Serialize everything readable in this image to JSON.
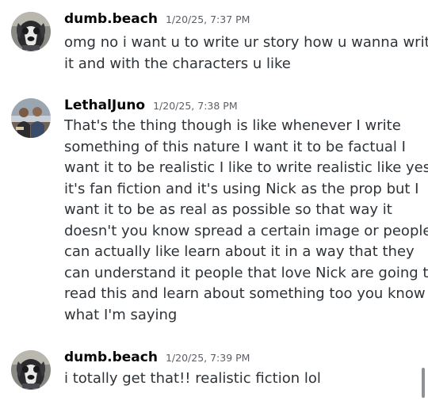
{
  "messages": [
    {
      "username": "dumb.beach",
      "timestamp": "1/20/25, 7:37 PM",
      "avatar_icon": "dog-avatar-icon",
      "lines": [
        "omg no i want u to write ur story how u wanna write",
        "it and with the characters u like"
      ]
    },
    {
      "username": "LethalJuno",
      "timestamp": "1/20/25, 7:38 PM",
      "avatar_icon": "person-avatar-icon",
      "lines": [
        "That's the thing though is like whenever I write",
        "something of this nature I want it to be factual I",
        "want it to be realistic I like to write realistic like yes",
        "it's fan fiction and it's using Nick as the prop but I",
        "want it to be as real as possible so that way it",
        "doesn't you know spread a certain image or people",
        "can actually like learn about it in a way that they",
        "can understand it people that love Nick are going to",
        "read this and learn about something too you know",
        "what I'm saying"
      ]
    },
    {
      "username": "dumb.beach",
      "timestamp": "1/20/25, 7:39 PM",
      "avatar_icon": "dog-avatar-icon",
      "lines": [
        "i totally get that!! realistic fiction lol"
      ]
    }
  ],
  "colors": {
    "username": "#060607",
    "timestamp": "#5c5e66",
    "text": "#2e3338",
    "scrollbar": "#8e9297"
  }
}
